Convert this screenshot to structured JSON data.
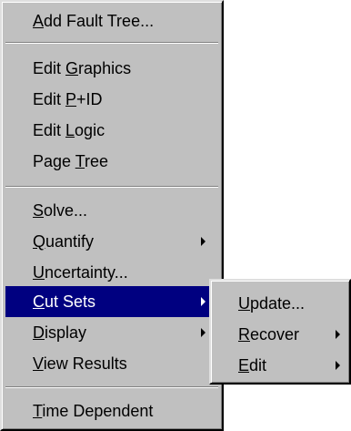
{
  "menu": {
    "items": [
      {
        "pre": "",
        "key": "A",
        "post": "dd Fault Tree...",
        "has_submenu": false
      },
      {
        "pre": "Edit ",
        "key": "G",
        "post": "raphics",
        "has_submenu": false
      },
      {
        "pre": "Edit ",
        "key": "P",
        "post": "+ID",
        "has_submenu": false
      },
      {
        "pre": "Edit ",
        "key": "L",
        "post": "ogic",
        "has_submenu": false
      },
      {
        "pre": "Page ",
        "key": "T",
        "post": "ree",
        "has_submenu": false
      },
      {
        "pre": "",
        "key": "S",
        "post": "olve...",
        "has_submenu": false
      },
      {
        "pre": "",
        "key": "Q",
        "post": "uantify",
        "has_submenu": true
      },
      {
        "pre": "",
        "key": "U",
        "post": "ncertainty...",
        "has_submenu": false
      },
      {
        "pre": "",
        "key": "C",
        "post": "ut Sets",
        "has_submenu": true,
        "active": true
      },
      {
        "pre": "",
        "key": "D",
        "post": "isplay",
        "has_submenu": true
      },
      {
        "pre": "",
        "key": "V",
        "post": "iew Results",
        "has_submenu": false
      },
      {
        "pre": "",
        "key": "T",
        "post": "ime Dependent",
        "has_submenu": false
      }
    ]
  },
  "submenu": {
    "items": [
      {
        "pre": "",
        "key": "U",
        "post": "pdate...",
        "has_submenu": false
      },
      {
        "pre": "",
        "key": "R",
        "post": "ecover",
        "has_submenu": true
      },
      {
        "pre": "",
        "key": "E",
        "post": "dit",
        "has_submenu": true
      }
    ]
  },
  "colors": {
    "menu_bg": "#c0c0c0",
    "highlight_bg": "#000080",
    "highlight_text": "#ffffff"
  }
}
